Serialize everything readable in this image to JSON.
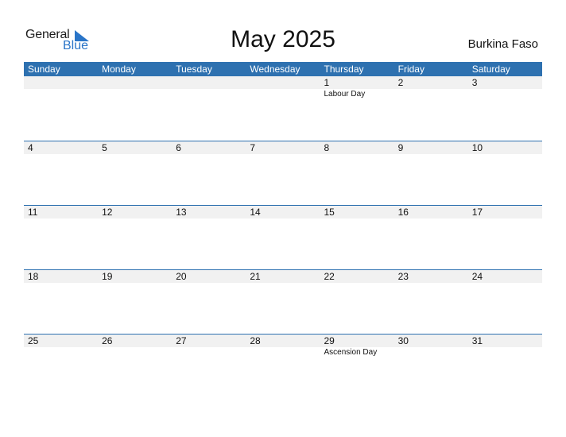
{
  "logo": {
    "line1": "General",
    "line2": "Blue"
  },
  "title": "May 2025",
  "country": "Burkina Faso",
  "colors": {
    "header_bg": "#2e71b0",
    "logo_blue": "#2a75c8",
    "date_strip": "#f1f1f1"
  },
  "days": [
    "Sunday",
    "Monday",
    "Tuesday",
    "Wednesday",
    "Thursday",
    "Friday",
    "Saturday"
  ],
  "weeks": [
    [
      {
        "d": "",
        "e": ""
      },
      {
        "d": "",
        "e": ""
      },
      {
        "d": "",
        "e": ""
      },
      {
        "d": "",
        "e": ""
      },
      {
        "d": "1",
        "e": "Labour Day"
      },
      {
        "d": "2",
        "e": ""
      },
      {
        "d": "3",
        "e": ""
      }
    ],
    [
      {
        "d": "4",
        "e": ""
      },
      {
        "d": "5",
        "e": ""
      },
      {
        "d": "6",
        "e": ""
      },
      {
        "d": "7",
        "e": ""
      },
      {
        "d": "8",
        "e": ""
      },
      {
        "d": "9",
        "e": ""
      },
      {
        "d": "10",
        "e": ""
      }
    ],
    [
      {
        "d": "11",
        "e": ""
      },
      {
        "d": "12",
        "e": ""
      },
      {
        "d": "13",
        "e": ""
      },
      {
        "d": "14",
        "e": ""
      },
      {
        "d": "15",
        "e": ""
      },
      {
        "d": "16",
        "e": ""
      },
      {
        "d": "17",
        "e": ""
      }
    ],
    [
      {
        "d": "18",
        "e": ""
      },
      {
        "d": "19",
        "e": ""
      },
      {
        "d": "20",
        "e": ""
      },
      {
        "d": "21",
        "e": ""
      },
      {
        "d": "22",
        "e": ""
      },
      {
        "d": "23",
        "e": ""
      },
      {
        "d": "24",
        "e": ""
      }
    ],
    [
      {
        "d": "25",
        "e": ""
      },
      {
        "d": "26",
        "e": ""
      },
      {
        "d": "27",
        "e": ""
      },
      {
        "d": "28",
        "e": ""
      },
      {
        "d": "29",
        "e": "Ascension Day"
      },
      {
        "d": "30",
        "e": ""
      },
      {
        "d": "31",
        "e": ""
      }
    ]
  ]
}
